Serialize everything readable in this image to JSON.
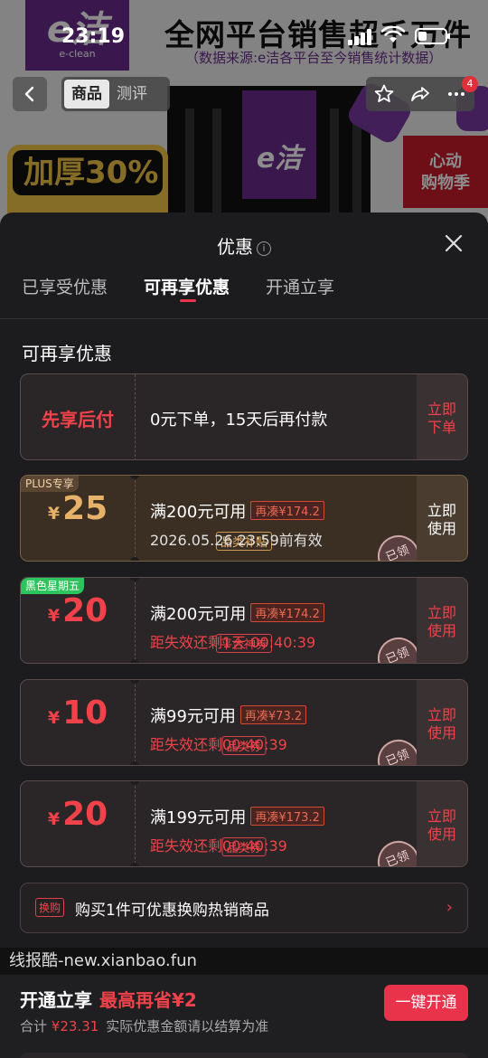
{
  "status_bar": {
    "time": "23:19"
  },
  "background": {
    "logo_text": "e洁",
    "logo_sub": "e-clean",
    "headline": "全网平台销售超千万件",
    "source_note": "（数据来源:e洁各平台至今销售统计数据）",
    "badge_text": "加厚30%",
    "promo_text_1": "心动",
    "promo_text_2": "购物季",
    "ribbon_text": "e洁"
  },
  "nav": {
    "tabs": [
      {
        "label": "商品",
        "active": true
      },
      {
        "label": "测评",
        "active": false
      }
    ],
    "cart_count": "4"
  },
  "sheet": {
    "title": "优惠",
    "info_icon": "ⓘ",
    "tabs": [
      {
        "label": "已享受优惠"
      },
      {
        "label": "可再享优惠"
      },
      {
        "label": "开通立享"
      }
    ],
    "section_title": "可再享优惠",
    "prepay": {
      "label": "先享后付",
      "text": "0元下单，15天后再付款",
      "button": "立即下单"
    },
    "coupons": [
      {
        "corner": "PLUS专享",
        "currency": "¥",
        "amount": "25",
        "tag": "品类补贴",
        "condition": "满200元可用",
        "extra": "再凑¥174.2",
        "sub": "2026.05.26 23:59前有效",
        "button": "立即使用",
        "stamp": "已领"
      },
      {
        "corner": "黑色星期五",
        "currency": "¥",
        "amount": "20",
        "tag": "平台神券",
        "condition": "满200元可用",
        "extra": "再凑¥174.2",
        "sub": "距失效还剩1天 00:40:39",
        "button": "立即使用",
        "stamp": "已领"
      },
      {
        "corner": "",
        "currency": "¥",
        "amount": "10",
        "tag": "品类券",
        "condition": "满99元可用",
        "extra": "再凑¥73.2",
        "sub": "距失效还剩00:40:39",
        "button": "立即使用",
        "stamp": "已领"
      },
      {
        "corner": "",
        "currency": "¥",
        "amount": "20",
        "tag": "品类券",
        "condition": "满199元可用",
        "extra": "再凑¥173.2",
        "sub": "距失效还剩00:40:39",
        "button": "立即使用",
        "stamp": "已领"
      }
    ],
    "swap": {
      "tag": "换购",
      "text": "购买1件可优惠换购热销商品",
      "arrow": "›"
    }
  },
  "watermark": "线报酷-new.xianbao.fun",
  "footer": {
    "title": "开通立享",
    "save": "最高再省¥2",
    "sum_label": "合计",
    "sum_price": "¥23.31",
    "sum_note": "实际优惠金额请以结算为准",
    "button": "一键开通"
  }
}
